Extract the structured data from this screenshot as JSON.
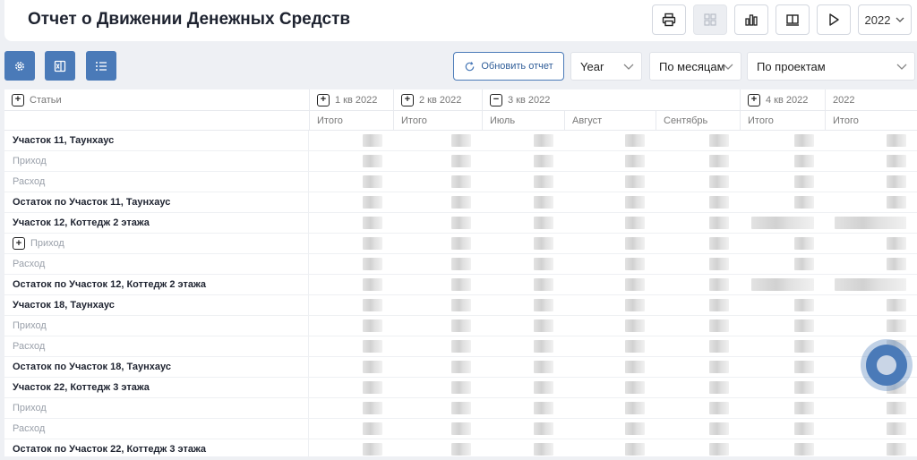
{
  "header": {
    "title": "Отчет о Движении Денежных Средств",
    "year_label": "2022"
  },
  "toolbar": {
    "refresh_label": "Обновить отчет",
    "period_select": "Year",
    "grouping_select": "По месяцам",
    "projects_select": "По проектам"
  },
  "table": {
    "articles_header": "Статьи",
    "groups": [
      {
        "label": "1 кв 2022",
        "toggle": "+"
      },
      {
        "label": "2 кв 2022",
        "toggle": "+"
      },
      {
        "label": "3 кв 2022",
        "toggle": "−"
      },
      {
        "label": "4 кв 2022",
        "toggle": "+"
      },
      {
        "label": "2022",
        "toggle": ""
      }
    ],
    "columns": [
      "Итого",
      "Итого",
      "Июль",
      "Август",
      "Сентябрь",
      "Итого",
      "Итого"
    ],
    "rows": [
      {
        "label": "Участок 11, Таунхаус",
        "style": "bold"
      },
      {
        "label": "Приход",
        "style": "muted"
      },
      {
        "label": "Расход",
        "style": "muted"
      },
      {
        "label": "Остаток по Участок 11, Таунхаус",
        "style": "bold"
      },
      {
        "label": "Участок 12, Коттедж 2 этажа",
        "style": "bold"
      },
      {
        "label": "Приход",
        "style": "muted",
        "toggle": "+"
      },
      {
        "label": "Расход",
        "style": "muted"
      },
      {
        "label": "Остаток по Участок 12, Коттедж 2 этажа",
        "style": "bold"
      },
      {
        "label": "Участок 18, Таунхаус",
        "style": "bold"
      },
      {
        "label": "Приход",
        "style": "muted"
      },
      {
        "label": "Расход",
        "style": "muted"
      },
      {
        "label": "Остаток по Участок 18, Таунхаус",
        "style": "bold"
      },
      {
        "label": "Участок 22, Коттедж 3 этажа",
        "style": "bold"
      },
      {
        "label": "Приход",
        "style": "muted"
      },
      {
        "label": "Расход",
        "style": "muted"
      },
      {
        "label": "Остаток по Участок 22, Коттедж 3 этажа",
        "style": "bold"
      }
    ]
  },
  "colors": {
    "accent": "#4a7ab8",
    "background": "#eef0f4"
  }
}
